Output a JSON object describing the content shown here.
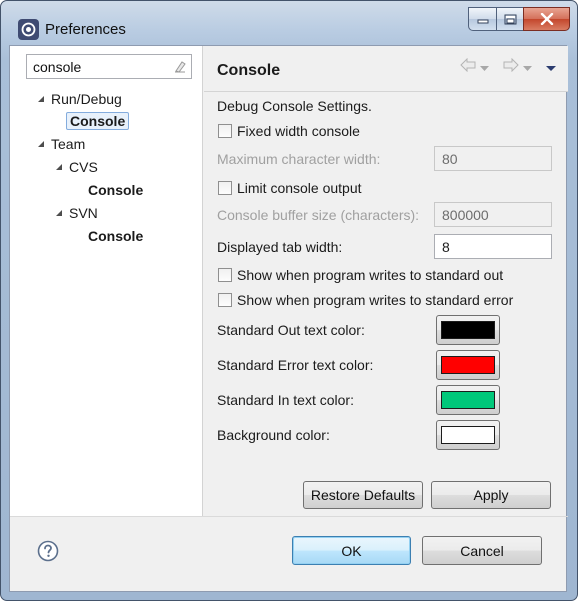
{
  "window": {
    "title": "Preferences"
  },
  "filter": {
    "value": "console"
  },
  "tree": {
    "run_debug": "Run/Debug",
    "run_debug_console": "Console",
    "team": "Team",
    "cvs": "CVS",
    "cvs_console": "Console",
    "svn": "SVN",
    "svn_console": "Console"
  },
  "page": {
    "title": "Console",
    "section_label": "Debug Console Settings.",
    "fixed_width": {
      "label": "Fixed width console",
      "checked": false
    },
    "max_char_width": {
      "label": "Maximum character width:",
      "value": "80"
    },
    "limit_output": {
      "label": "Limit console output",
      "checked": false
    },
    "buffer_size": {
      "label": "Console buffer size (characters):",
      "value": "800000"
    },
    "tab_width": {
      "label": "Displayed tab width:",
      "value": "8"
    },
    "show_stdout": {
      "label": "Show when program writes to standard out",
      "checked": false
    },
    "show_stderr": {
      "label": "Show when program writes to standard error",
      "checked": false
    },
    "colors": [
      {
        "label": "Standard Out text color:",
        "color": "#000000"
      },
      {
        "label": "Standard Error text color:",
        "color": "#ff0000"
      },
      {
        "label": "Standard In text color:",
        "color": "#00c87a"
      },
      {
        "label": "Background color:",
        "color": "#ffffff"
      }
    ],
    "restore_defaults": "Restore Defaults",
    "apply": "Apply"
  },
  "footer": {
    "ok": "OK",
    "cancel": "Cancel"
  },
  "icons": {
    "app": "eclipse-icon",
    "clear": "clear-filter-icon",
    "back": "back-arrow-icon",
    "forward": "forward-arrow-icon",
    "menu": "view-menu-icon",
    "help": "help-icon"
  }
}
